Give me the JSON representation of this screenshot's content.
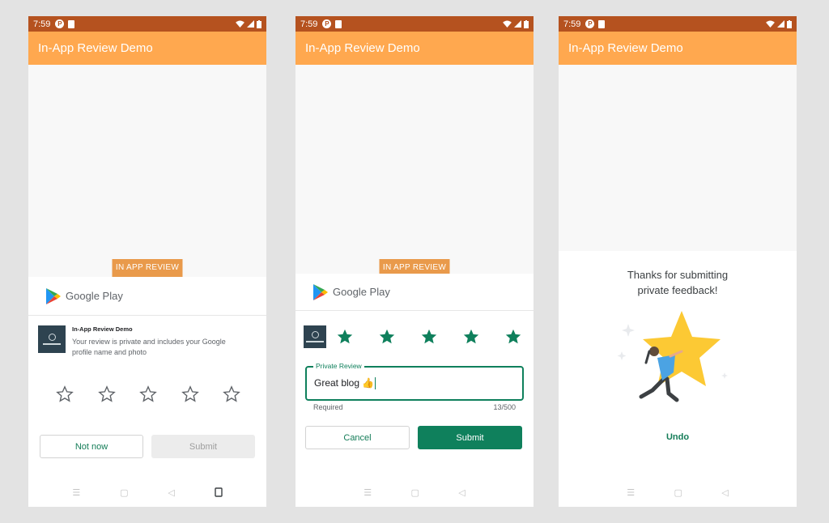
{
  "status": {
    "time": "7:59",
    "badge": "P"
  },
  "app_title": "In-App Review Demo",
  "trigger_button": "IN APP REVIEW",
  "google_play_label": "Google Play",
  "screen1": {
    "app_name": "In-App Review Demo",
    "privacy_note": "Your review is private and includes your Google profile name and photo",
    "not_now_label": "Not now",
    "submit_label": "Submit"
  },
  "screen2": {
    "field_label": "Private Review",
    "field_value": "Great blog 👍",
    "helper_left": "Required",
    "helper_right": "13/500",
    "cancel_label": "Cancel",
    "submit_label": "Submit"
  },
  "screen3": {
    "thanks_line1": "Thanks for submitting",
    "thanks_line2": "private feedback!",
    "undo_label": "Undo"
  },
  "colors": {
    "status_bar": "#b5521f",
    "app_bar": "#ffa84f",
    "accent_green": "#0f805c",
    "star_yellow": "#fcc934"
  }
}
